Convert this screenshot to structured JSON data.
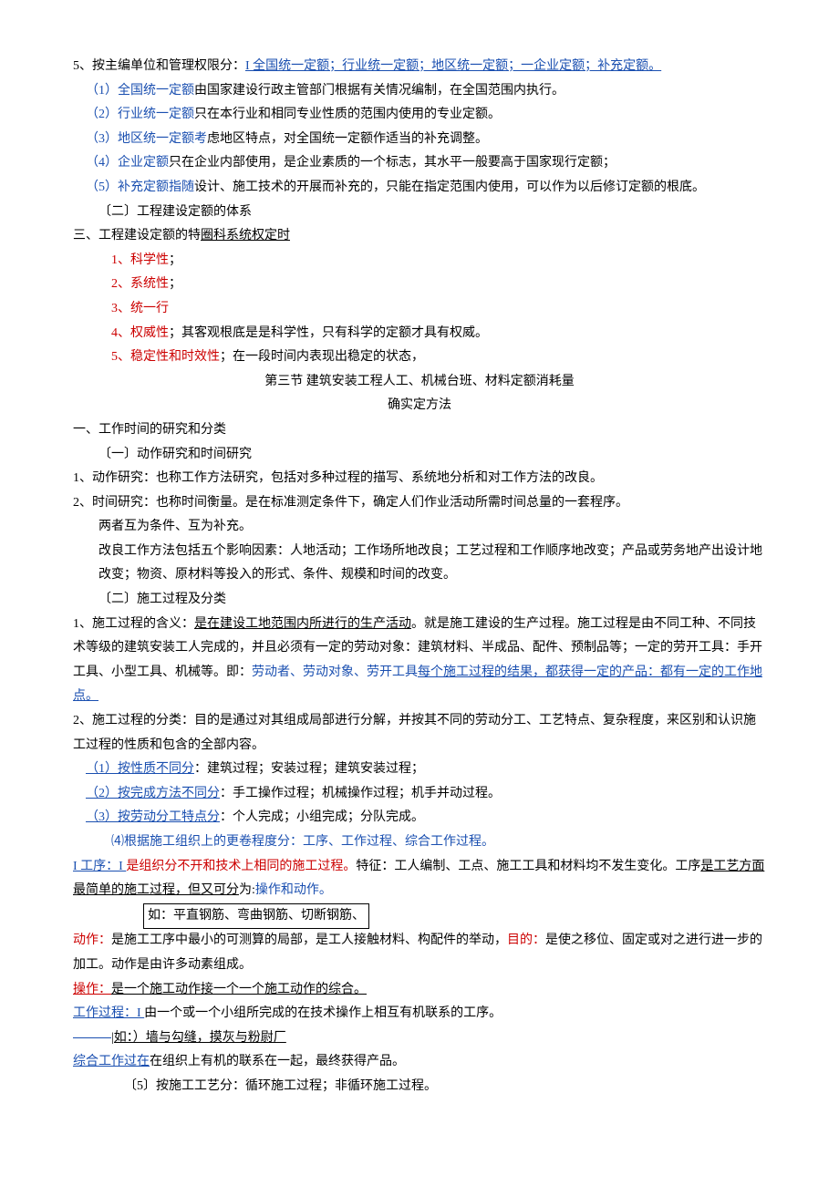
{
  "l1": {
    "a": "5、按主编单位和管理权限分：",
    "b": "I 全国统一定额；行业统一定额；地区统一定额；一企业定额；补充定额。"
  },
  "l2": {
    "a": "（1）全国统一定额",
    "b": "由国家建设行政主管部门根据有关情况编制，在全国范围内执行。"
  },
  "l3": {
    "a": "（2）行业统一定额",
    "b": "只在本行业和相同专业性质的范围内使用的专业定额。"
  },
  "l4": {
    "a": "（3）地区统一定额考",
    "b": "虑地区特点，对全国统一定额作适当的补充调整。"
  },
  "l5": {
    "a": "（4）企业定额",
    "b": "只在企业内部使用，是企业素质的一个标志，其水平一般要高于国家现行定额；"
  },
  "l6": {
    "a": "（5）补充定额指随",
    "b": "设计、施工技术的开展而补充的，只能在指定范围内使用，可以作为以后修订定额的根底。"
  },
  "l7": "〔二〕工程建设定额的体系",
  "l8": {
    "a": "三、工程建设定额的特",
    "b": "圈科系统权定时"
  },
  "l9": {
    "a": "1、",
    "b": "科学性",
    "c": "；"
  },
  "l10": {
    "a": "2、",
    "b": "系统性",
    "c": "；"
  },
  "l11": {
    "a": "3、",
    "b": "统一行"
  },
  "l12": {
    "a": "4、",
    "b": "权威性",
    "c": "；其客观根底是是科学性，只有科学的定额才具有权威。"
  },
  "l13": {
    "a": "5、",
    "b": "稳定性和时效性",
    "c": "；在一段时间内表现出稳定的状态，"
  },
  "l14": "第三节 建筑安装工程人工、机械台班、材料定额消耗量",
  "l15": "确实定方法",
  "l16": "一、工作时间的研究和分类",
  "l17": "〔一〕动作研究和时间研究",
  "l18": "1、动作研究：也称工作方法研究，包括对多种过程的描写、系统地分析和对工作方法的改良。",
  "l19": "2、时间研究：也称时间衡量。是在标准测定条件下，确定人们作业活动所需时间总量的一套程序。",
  "l20": "两者互为条件、互为补充。",
  "l21": "改良工作方法包括五个影响因素：人地活动；工作场所地改良；工艺过程和工作顺序地改变；产品或劳务地产出设计地改变；物资、原材料等投入的形式、条件、规模和时间的改变。",
  "l22": "〔二〕施工过程及分类",
  "l23": {
    "a": "1、施工过程的含义：",
    "b": "是在建设工地范围内所进行的生产活动",
    "c": "。就是施工建设的生产过程。施工过程是由不同工种、不同技术等级的建筑安装工人完成的，并且必须有一定的劳动对象：建筑材料、半成品、配件、预制品等；一定的劳开工具：手开工具、小型工具、机械等。即：",
    "d": "劳动者、劳动对象、劳开工具",
    "e": "每个施工过程的结果，都获得一定的产品：都有一定的工作地点。"
  },
  "l24": "2、施工过程的分类：目的是通过对其组成局部进行分解，并按其不同的劳动分工、工艺特点、复杂程度，来区别和认识施工过程的性质和包含的全部内容。",
  "l25": {
    "a": "（1）按性质不同分",
    "b": "：建筑过程；安装过程；建筑安装过程；"
  },
  "l26": {
    "a": "（2）按完成方法不同分",
    "b": "：手工操作过程；机械操作过程；机手并动过程。"
  },
  "l27": {
    "a": "（3）按劳动分工特点分",
    "b": "：个人完成；小组完成；分队完成。"
  },
  "l28": "⑷根据施工组织上的更卷程度分：工序、工作过程、综合工作过程。",
  "l29": {
    "a": "I 工序：I ",
    "b": "是组织分不开和技术上相同的施工过程。",
    "c": "特征：工人编制、工点、施工工具和材料均不发生变化。工序",
    "d": "是工艺方面最简单的施工过程，但又可分",
    "e": "为:",
    "f": "操作和动作。"
  },
  "l30": "如：平直钢筋、弯曲钢筋、切断钢筋、",
  "l31": {
    "a": "动作：",
    "b": "是施工工序中最小的可测算的局部，是工人接触材料、构配件的举动，",
    "c": "目的：",
    "d": "是使之移位、固定或对之进行进一步的加工。动作是由许多动素组成。"
  },
  "l32": {
    "a": "操作：",
    "b": "是一个施工动作接一个一个施工动作的综合。"
  },
  "l33": {
    "a": "工作过程：I ",
    "b": "由一个或一个小组所完成的在技术操作上相互有机联系的工序。"
  },
  "l34": "|如：）墙与勾缝，摸灰与粉尉厂",
  "l35": {
    "a": "综合工作过在",
    "b": "在组织上有机的联系在一起，最终获得产品。"
  },
  "l36": "〔5〕按施工工艺分：循环施工过程；非循环施工过程。"
}
